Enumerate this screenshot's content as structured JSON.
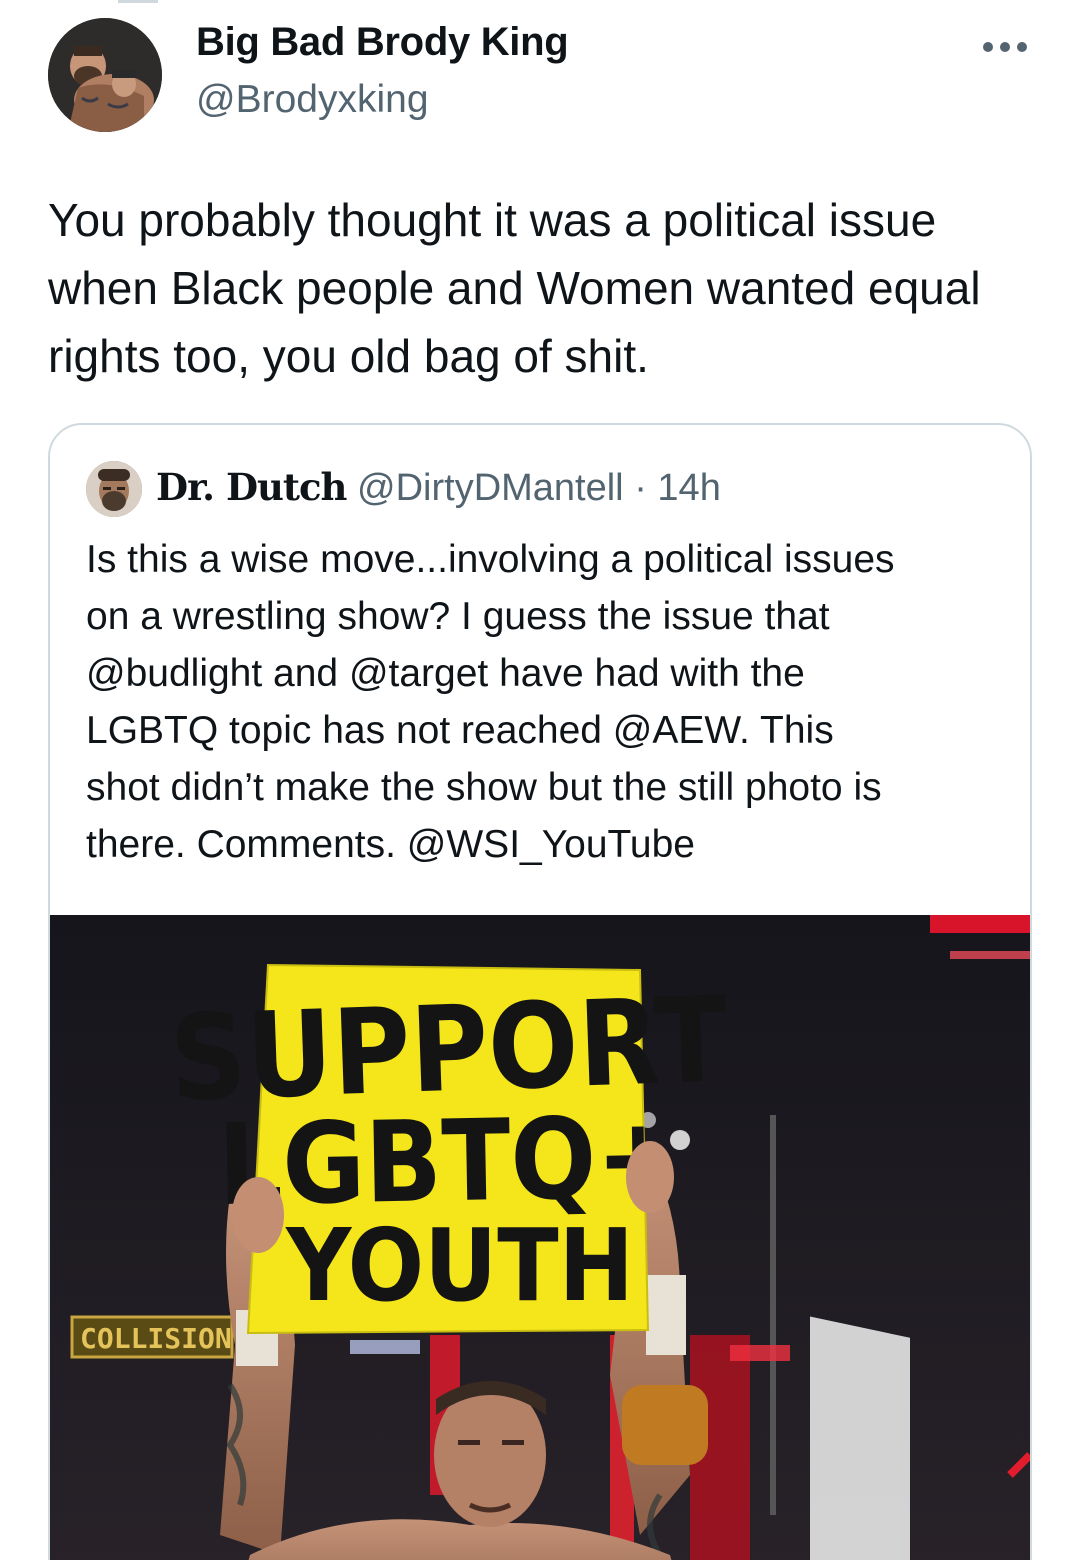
{
  "author": {
    "display_name": "Big Bad Brody King",
    "handle": "@Brodyxking",
    "avatar_icon": "profile-photo"
  },
  "more_icon": "more-options-icon",
  "tweet": {
    "text": "You probably thought it was a political issue when Black people and Women wanted equal rights too, you old bag of shit."
  },
  "quoted": {
    "display_name": "Dr. Dutch",
    "handle": "@DirtyDMantell",
    "separator": "·",
    "time": "14h",
    "text": "Is this a wise move...involving a political issues\non a wrestling show?  I guess the issue that\n@budlight and @target have had with the\nLGBTQ topic has  not reached @AEW.  This\nshot didn’t make the show but the still photo is\nthere.  Comments. @WSI_YouTube",
    "media": {
      "sign_lines": [
        "SUPPORT",
        "LGBTQ+",
        "YOUTH"
      ],
      "banner_text": "COLLISION",
      "sign_color": "#f4e61a",
      "ring_rope_color": "#d8142a"
    }
  },
  "colors": {
    "text_primary": "#0f1419",
    "text_secondary": "#536471",
    "border": "#cfd9de"
  }
}
